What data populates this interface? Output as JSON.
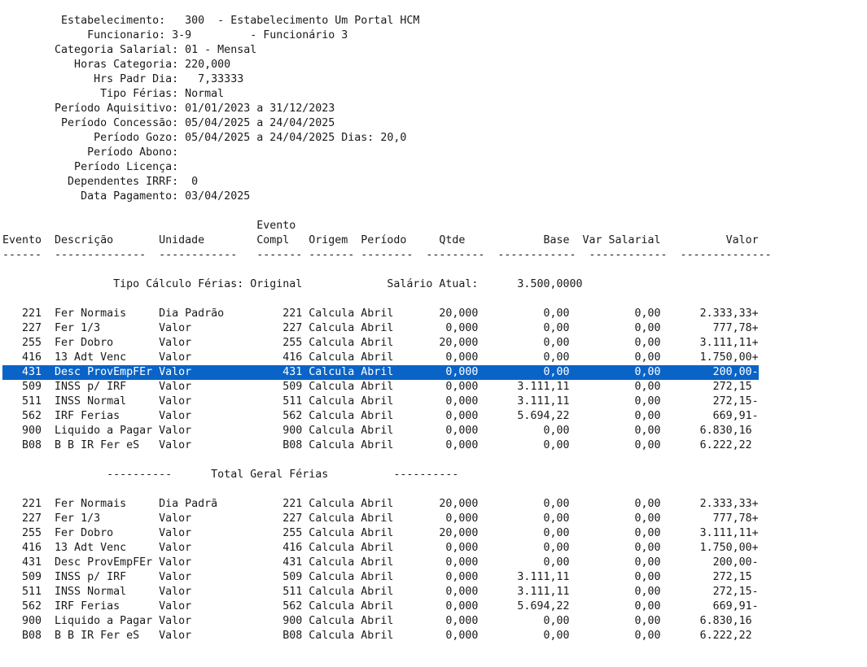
{
  "header": {
    "estabelecimento": "         Estabelecimento:   300  - Estabelecimento Um Portal HCM",
    "funcionario": "             Funcionario: 3-9         - Funcionário 3",
    "categoria_salarial": "        Categoria Salarial: 01 - Mensal",
    "horas_categoria": "           Horas Categoria: 220,000",
    "hrs_padr_dia": "              Hrs Padr Dia:   7,33333",
    "tipo_ferias": "               Tipo Férias: Normal",
    "periodo_aquisitivo": "        Período Aquisitivo: 01/01/2023 a 31/12/2023",
    "periodo_concessao": "         Período Concessão: 05/04/2025 a 24/04/2025",
    "periodo_gozo": "              Período Gozo: 05/04/2025 a 24/04/2025 Dias: 20,0",
    "periodo_abono": "             Período Abono:",
    "periodo_licenca": "           Período Licença:",
    "dependentes_irrf": "          Dependentes IRRF:  0",
    "data_pagamento": "            Data Pagamento: 03/04/2025"
  },
  "columns": {
    "header_line1": "                                       Evento",
    "header_line2": "Evento  Descrição       Unidade        Compl   Origem  Período     Qtde            Base  Var Salarial          Valor",
    "separator": "------  --------------  ------------   ------- ------- --------  ---------  ------------  ------------  --------------"
  },
  "section_original": {
    "title_line": "                 Tipo Cálculo Férias: Original             Salário Atual:      3.500,0000",
    "rows": [
      "   221  Fer Normais     Dia Padrão         221 Calcula Abril       20,000          0,00          0,00      2.333,33+",
      "   227  Fer 1/3         Valor              227 Calcula Abril        0,000          0,00          0,00        777,78+",
      "   255  Fer Dobro       Valor              255 Calcula Abril       20,000          0,00          0,00      3.111,11+",
      "   416  13 Adt Venc     Valor              416 Calcula Abril        0,000          0,00          0,00      1.750,00+",
      "   431  Desc ProvEmpFEr Valor              431 Calcula Abril        0,000          0,00          0,00        200,00-",
      "   509  INSS p/ IRF     Valor              509 Calcula Abril        0,000      3.111,11          0,00        272,15",
      "   511  INSS Normal     Valor              511 Calcula Abril        0,000      3.111,11          0,00        272,15-",
      "   562  IRF Ferias      Valor              562 Calcula Abril        0,000      5.694,22          0,00        669,91-",
      "   900  Liquido a Pagar Valor              900 Calcula Abril        0,000          0,00          0,00      6.830,16",
      "   B08  B B IR Fer eS   Valor              B08 Calcula Abril        0,000          0,00          0,00      6.222,22"
    ]
  },
  "section_total": {
    "title_line": "                ----------      Total Geral Férias          ----------",
    "rows": [
      "   221  Fer Normais     Dia Padrã          221 Calcula Abril       20,000          0,00          0,00      2.333,33+",
      "   227  Fer 1/3         Valor              227 Calcula Abril        0,000          0,00          0,00        777,78+",
      "   255  Fer Dobro       Valor              255 Calcula Abril       20,000          0,00          0,00      3.111,11+",
      "   416  13 Adt Venc     Valor              416 Calcula Abril        0,000          0,00          0,00      1.750,00+",
      "   431  Desc ProvEmpFEr Valor              431 Calcula Abril        0,000          0,00          0,00        200,00-",
      "   509  INSS p/ IRF     Valor              509 Calcula Abril        0,000      3.111,11          0,00        272,15",
      "   511  INSS Normal     Valor              511 Calcula Abril        0,000      3.111,11          0,00        272,15-",
      "   562  IRF Ferias      Valor              562 Calcula Abril        0,000      5.694,22          0,00        669,91-",
      "   900  Liquido a Pagar Valor              900 Calcula Abril        0,000          0,00          0,00      6.830,16",
      "   B08  B B IR Fer eS   Valor              B08 Calcula Abril        0,000          0,00          0,00      6.222,22"
    ]
  },
  "selection": {
    "highlight_color": "#0a64c8",
    "selected_row": "Desc ProvEmpFEr"
  }
}
